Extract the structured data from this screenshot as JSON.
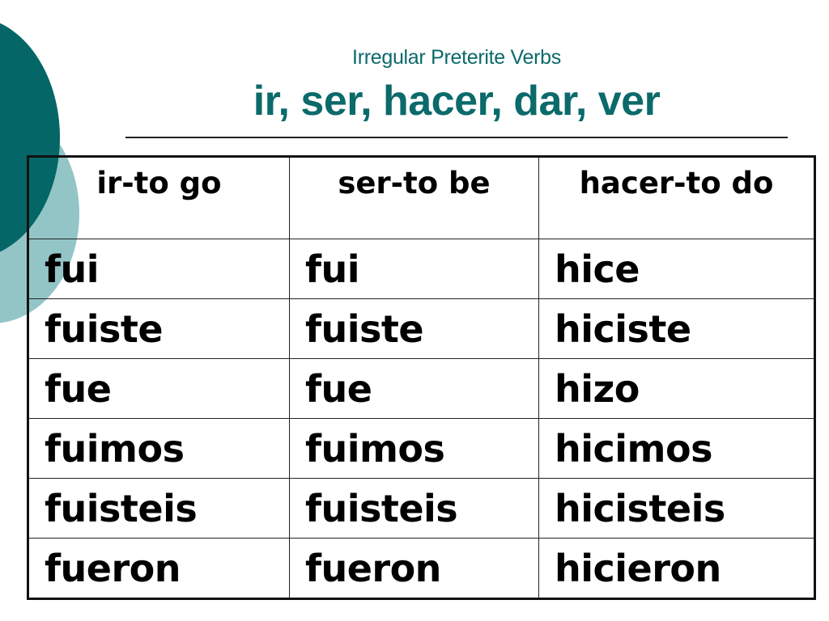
{
  "slide": {
    "subtitle": "Irregular Preterite Verbs",
    "title": "ir, ser, hacer, dar, ver",
    "colors": {
      "title": "#0b6a6a",
      "circle_dark": "#046666",
      "circle_light": "#93c5c7"
    }
  },
  "table": {
    "headers": [
      "ir-to go",
      "ser-to be",
      "hacer-to do"
    ],
    "rows": [
      [
        "fui",
        "fui",
        "hice"
      ],
      [
        "fuiste",
        "fuiste",
        "hiciste"
      ],
      [
        "fue",
        "fue",
        "hizo"
      ],
      [
        "fuimos",
        "fuimos",
        "hicimos"
      ],
      [
        "fuisteis",
        "fuisteis",
        "hicisteis"
      ],
      [
        "fueron",
        "fueron",
        "hicieron"
      ]
    ]
  }
}
